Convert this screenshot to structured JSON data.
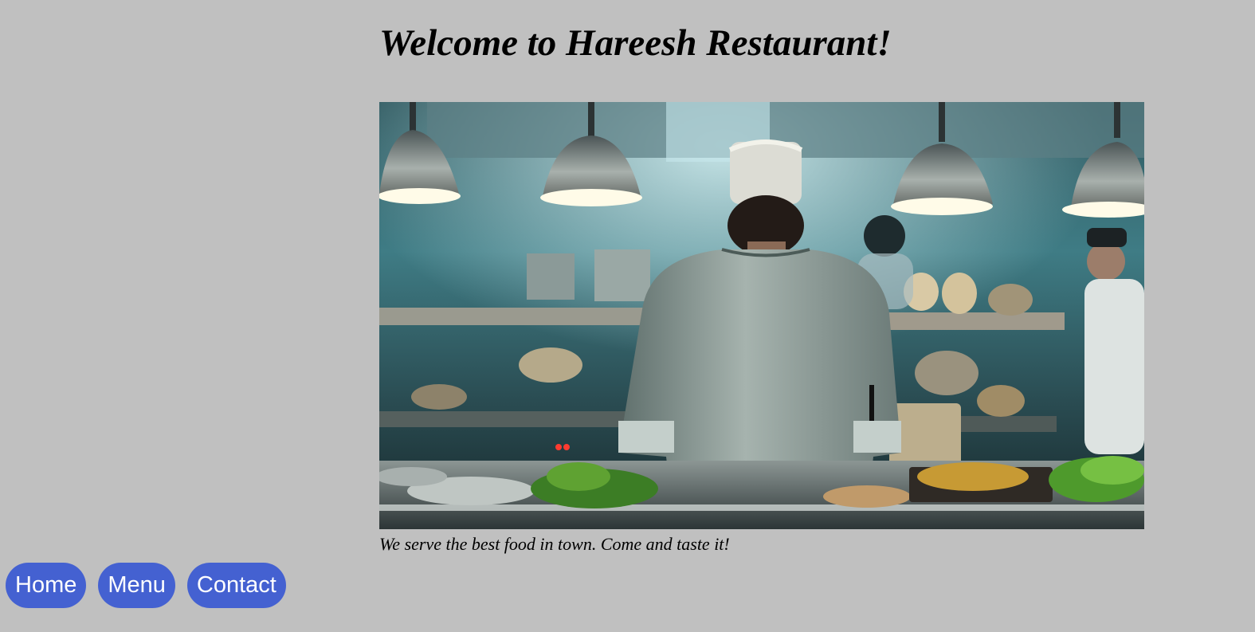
{
  "page": {
    "title": "Welcome to Hareesh Restaurant!",
    "caption": "We serve the best food in town. Come and taste it!",
    "hero_image_alt": "chef-in-restaurant-kitchen"
  },
  "nav": {
    "items": [
      {
        "label": "Home"
      },
      {
        "label": "Menu"
      },
      {
        "label": "Contact"
      }
    ]
  },
  "colors": {
    "background": "#c0c0c0",
    "button": "#4461d1",
    "button_text": "#ffffff"
  }
}
